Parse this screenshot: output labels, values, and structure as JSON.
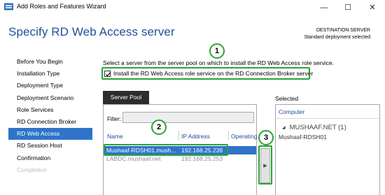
{
  "window": {
    "title": "Add Roles and Features Wizard",
    "minimize_glyph": "—",
    "maximize_glyph": "☐",
    "close_glyph": "✕"
  },
  "header": {
    "title": "Specify RD Web Access server",
    "destination_label": "DESTINATION SERVER",
    "destination_value": "Standard deployment selected"
  },
  "nav": {
    "items": [
      {
        "label": "Before You Begin",
        "state": "normal"
      },
      {
        "label": "Installation Type",
        "state": "normal"
      },
      {
        "label": "Deployment Type",
        "state": "normal"
      },
      {
        "label": "Deployment Scenario",
        "state": "normal"
      },
      {
        "label": "Role Services",
        "state": "normal"
      },
      {
        "label": "RD Connection Broker",
        "state": "normal"
      },
      {
        "label": "RD Web Access",
        "state": "active"
      },
      {
        "label": "RD Session Host",
        "state": "normal"
      },
      {
        "label": "Confirmation",
        "state": "normal"
      },
      {
        "label": "Completion",
        "state": "disabled"
      }
    ]
  },
  "main": {
    "instruction": "Select a server from the server pool on which to install the RD Web Access role service.",
    "checkbox_label": "Install the RD Web Access role service on the RD Connection Broker server",
    "checkbox_checked": true,
    "pool_tab": "Server Pool",
    "filter_label": "Filter:",
    "filter_value": "",
    "columns": {
      "name": "Name",
      "ip": "IP Address",
      "os": "Operating"
    },
    "rows": [
      {
        "name": "Mushaaf-RDSH01.mush...",
        "ip": "192.168.25.239",
        "selected": true
      },
      {
        "name": "LABDC.mushaaf.net",
        "ip": "192.168.25.253",
        "selected": false
      }
    ],
    "arrow_glyph": "▶"
  },
  "selected": {
    "label": "Selected",
    "column": "Computer",
    "group_glyph": "◢",
    "group": "MUSHAAF.NET (1)",
    "items": [
      "Mushaaf-RDSH01"
    ]
  },
  "callouts": [
    "1",
    "2",
    "3"
  ],
  "colors": {
    "accent": "#2f74c9",
    "title": "#1f4e9a",
    "annotation": "#2aa33a"
  }
}
